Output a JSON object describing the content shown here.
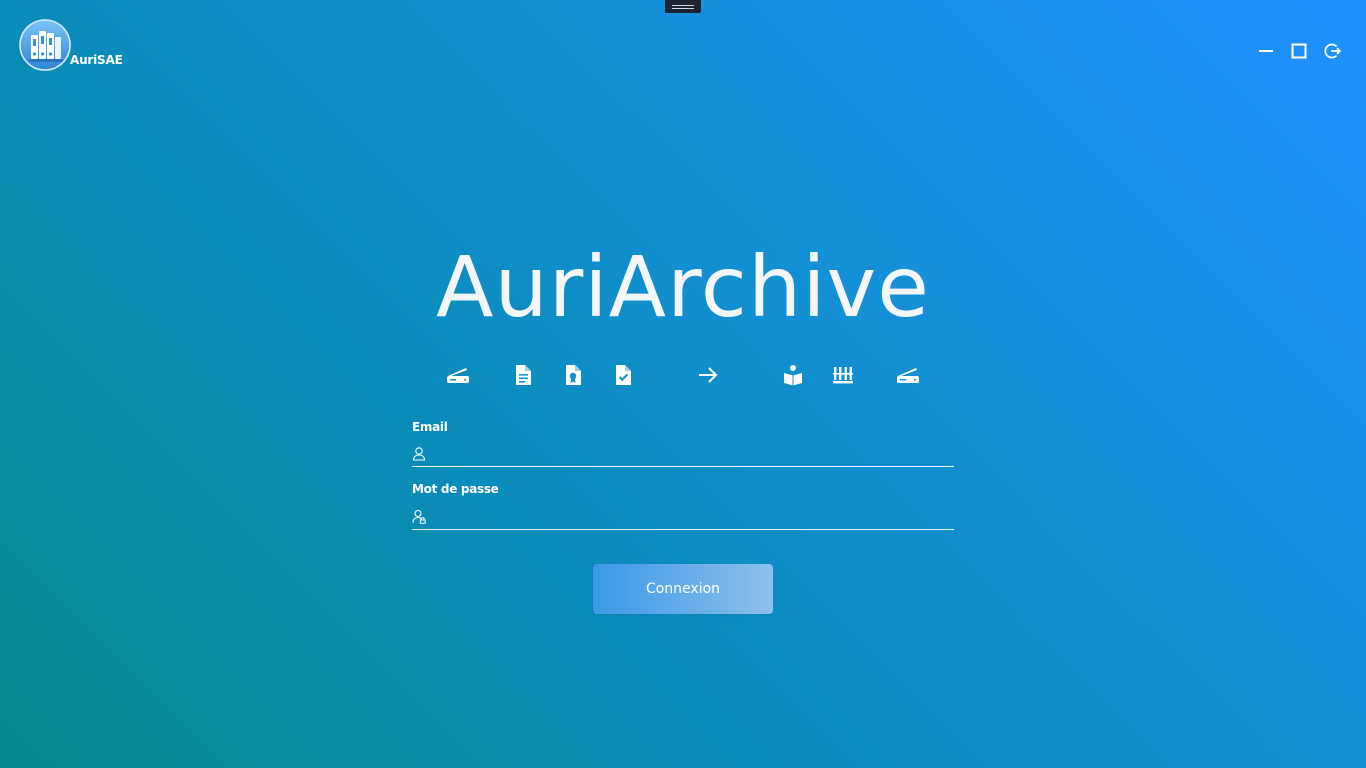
{
  "brand": {
    "name": "AuriSAE",
    "logo_icon": "archive-binders-logo"
  },
  "window_controls": {
    "icons": [
      "minimize-icon",
      "maximize-icon",
      "logout-icon"
    ]
  },
  "main": {
    "title": "AuriArchive",
    "workflow_icons": [
      "scanner-icon",
      "document-icon",
      "document-seal-icon",
      "document-check-icon",
      "arrow-right-icon",
      "reading-icon",
      "archive-shelf-icon",
      "scanner-icon"
    ]
  },
  "form": {
    "email_label": "Email",
    "email_value": "",
    "email_placeholder": "",
    "password_label": "Mot de passe",
    "password_value": "",
    "password_placeholder": "",
    "submit_label": "Connexion"
  },
  "colors": {
    "background_start": "#078a8c",
    "background_end": "#1e90ff",
    "button_start": "#3a98e6",
    "button_end": "#8ec0ea",
    "text": "#ffffff"
  }
}
